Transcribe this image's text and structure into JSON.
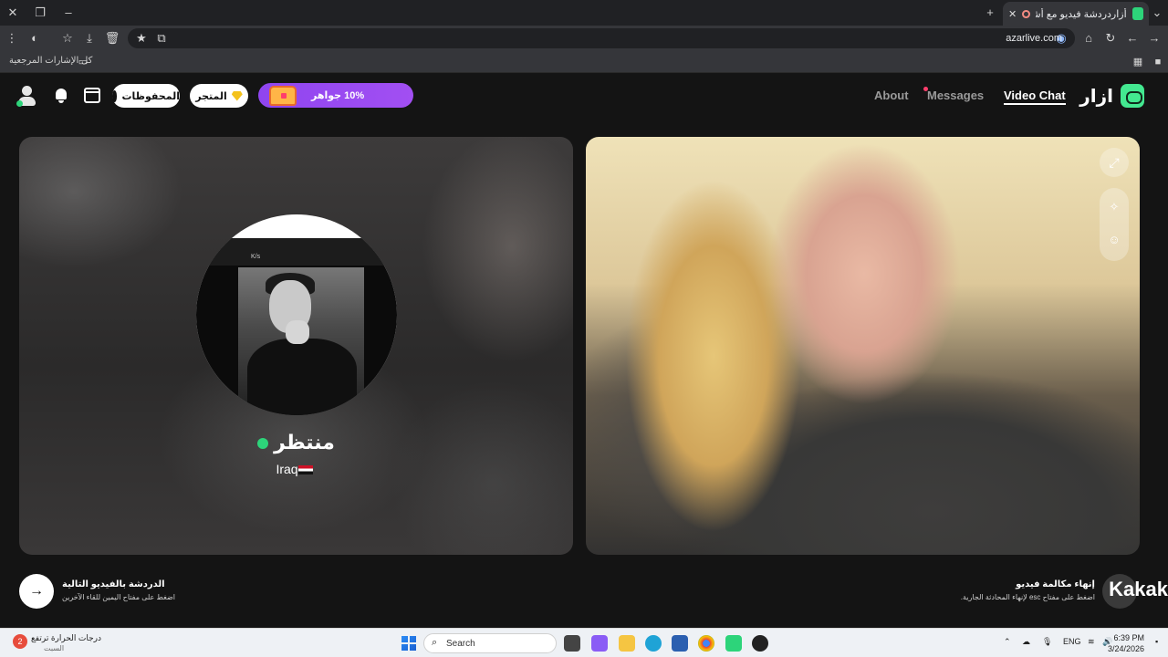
{
  "browser": {
    "tab_title": "أزاردردشة فيديو مع أشخاص",
    "url": "azarlive.com",
    "bookmarks_label": "كل الإشارات المرجعية"
  },
  "site": {
    "brand_name": "ازار",
    "nav": {
      "video_chat": "Video Chat",
      "messages": "Messages",
      "about": "About"
    },
    "gems_promo": "10% جواهر",
    "store_label": "المتجر",
    "saved_label": "المحفوظات"
  },
  "peer": {
    "name": "منتظر",
    "country": "Iraq",
    "avatar_overlay": "K/s"
  },
  "controls": {
    "next_title": "الدردشة بالفيديو التالية",
    "next_hint": "اضغط على مفتاح اليمين للقاء الآخرين",
    "end_title": "إنهاء مكالمة فيديو",
    "end_hint": "اضغط على مفتاح esc لإنهاء المحادثة الجارية.",
    "watermark": "Kakak"
  },
  "taskbar": {
    "weather_line1": "درجات الحرارة ترتفع",
    "weather_line2": "السبت",
    "weather_badge": "2",
    "search_placeholder": "Search",
    "lang": "ENG",
    "time": "6:39 PM",
    "date": "3/24/2026"
  },
  "colors": {
    "accent_green": "#43e890",
    "gems_purple": "#9b4bf1",
    "notification_red": "#ff3e6c"
  }
}
